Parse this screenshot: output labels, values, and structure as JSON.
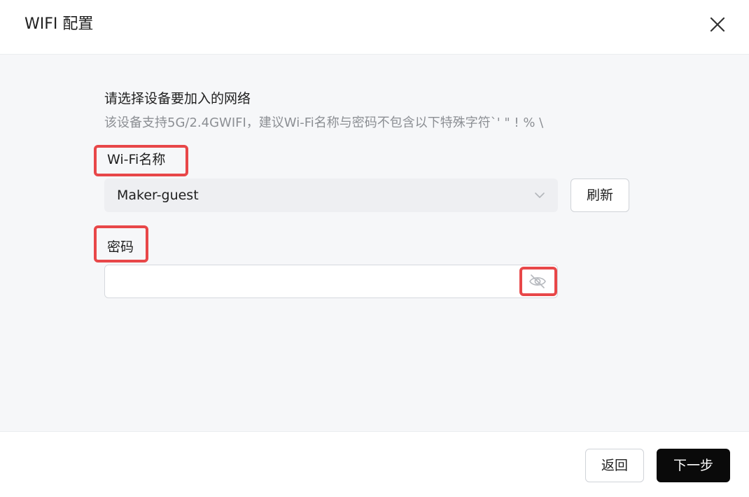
{
  "dialog": {
    "title": "WIFI 配置",
    "close_icon": "close-icon"
  },
  "form": {
    "heading": "请选择设备要加入的网络",
    "hint": "该设备支持5G/2.4GWIFI，建议Wi-Fi名称与密码不包含以下特殊字符`' \" ! % \\",
    "ssid_label": "Wi-Fi名称",
    "ssid_value": "Maker-guest",
    "refresh_label": "刷新",
    "password_label": "密码",
    "password_value": "",
    "password_toggle_icon": "eye-off-icon"
  },
  "footer": {
    "back_label": "返回",
    "next_label": "下一步"
  },
  "colors": {
    "highlight": "#e84749",
    "primary": "#0a0a0a",
    "body_bg": "#f6f7f9"
  }
}
